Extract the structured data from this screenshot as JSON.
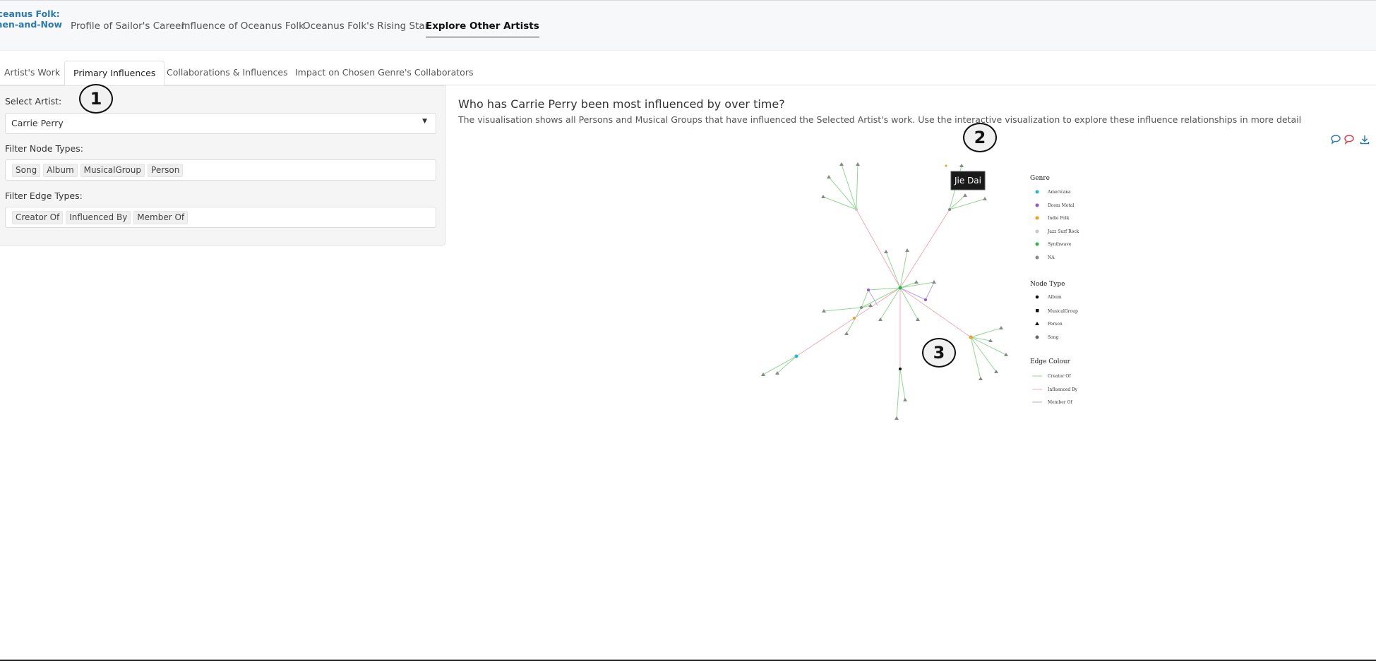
{
  "navbar": {
    "brand_line1": "Oceanus Folk:",
    "brand_line2": "Then-and-Now",
    "links": [
      {
        "label": "Profile of Sailor's Career"
      },
      {
        "label": "Influence of Oceanus Folk"
      },
      {
        "label": "Oceanus Folk's Rising Star"
      },
      {
        "label": "Explore Other Artists",
        "active": true
      }
    ]
  },
  "tabs": [
    {
      "label": "Artist's Work"
    },
    {
      "label": "Primary Influences",
      "active": true
    },
    {
      "label": "Collaborations & Influences"
    },
    {
      "label": "Impact on Chosen Genre's Collaborators"
    }
  ],
  "sidebar": {
    "artist_label": "Select Artist:",
    "artist_value": "Carrie Perry",
    "node_label": "Filter Node Types:",
    "node_tags": [
      "Song",
      "Album",
      "MusicalGroup",
      "Person"
    ],
    "edge_label": "Filter Edge Types:",
    "edge_tags": [
      "Creator Of",
      "Influenced By",
      "Member Of"
    ]
  },
  "main": {
    "title": "Who has Carrie Perry been most influenced by over time?",
    "description": "The visualisation shows all Persons and Musical Groups that have influenced the Selected Artist's work. Use the interactive visualization to explore these influence relationships in more detail"
  },
  "badges": [
    "1",
    "2",
    "3"
  ],
  "toolbar_icons": [
    "speech-bubble-icon",
    "speech-bubble-red-icon",
    "download-icon"
  ],
  "tooltip": "Jie Dai",
  "legend": {
    "genre_title": "Genre",
    "genres": [
      {
        "label": "Americana",
        "color": "#19b9d9"
      },
      {
        "label": "Doom Metal",
        "color": "#9b4fd1"
      },
      {
        "label": "Indie Folk",
        "color": "#f29b1d"
      },
      {
        "label": "Jazz Surf Rock",
        "color": "#c8c8c8"
      },
      {
        "label": "Synthwave",
        "color": "#2db34a"
      },
      {
        "label": "NA",
        "color": "#888888"
      }
    ],
    "node_title": "Node Type",
    "node_types": [
      "Album",
      "MusicalGroup",
      "Person",
      "Song"
    ],
    "edge_title": "Edge Colour",
    "edges": [
      {
        "label": "Creator Of",
        "color": "#8fd98f"
      },
      {
        "label": "Influenced By",
        "color": "#f4a9b8"
      },
      {
        "label": "Member Of",
        "color": "#b7a6e8"
      }
    ]
  },
  "colors": {
    "accent": "#2a7ab0",
    "creator_edge": "#8fd98f",
    "influence_edge": "#f4a9b8",
    "member_edge": "#b7a6e8"
  }
}
